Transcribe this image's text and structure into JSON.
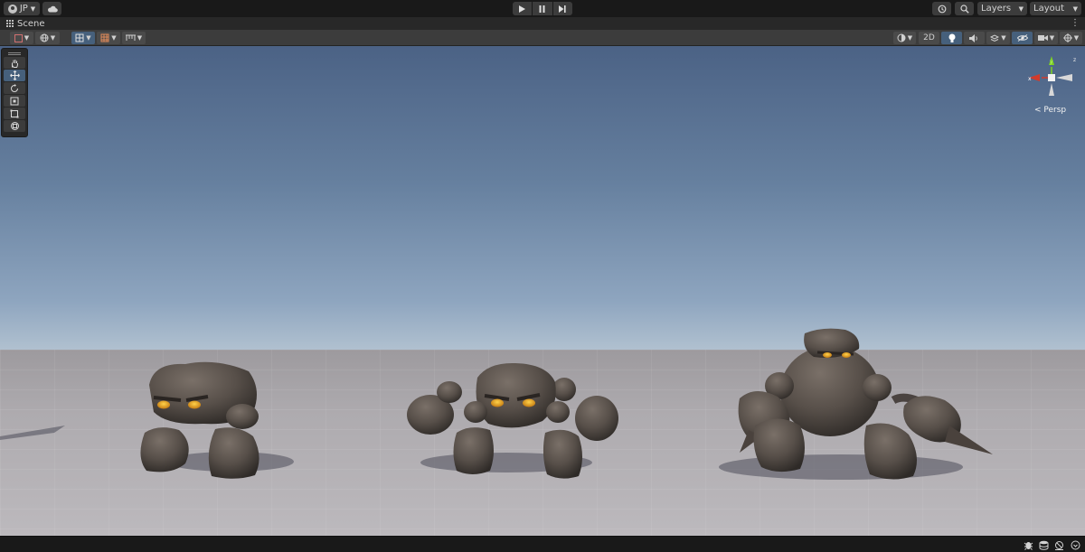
{
  "toolbar": {
    "account_label": "JP",
    "layers_label": "Layers",
    "layout_label": "Layout",
    "play_icon": "play-icon",
    "pause_icon": "pause-icon",
    "step_icon": "step-icon"
  },
  "scene_tab": {
    "title": "Scene"
  },
  "scene_toolbar": {
    "mode_2d_label": "2D"
  },
  "tools": [
    "view-tool",
    "move-tool",
    "rotate-tool",
    "scale-tool",
    "rect-tool",
    "transform-tool"
  ],
  "gizmo": {
    "projection_label": "< Persp",
    "x_axis_label": "x",
    "y_axis_label": "y"
  },
  "colors": {
    "accent": "#46607c",
    "x_axis": "#d23b2b",
    "y_axis": "#7ed321",
    "sky_top": "#4b6285",
    "ground": "#aeabaf"
  }
}
